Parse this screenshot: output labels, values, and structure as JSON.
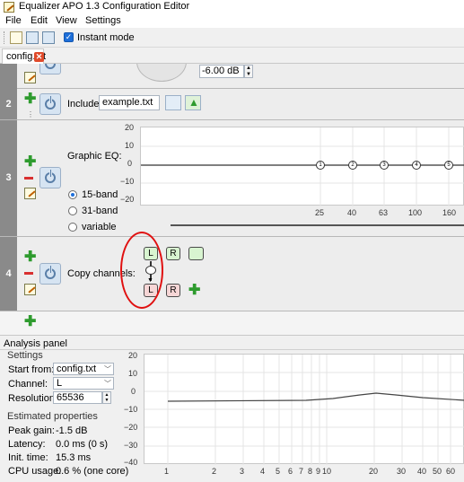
{
  "window": {
    "title": "Equalizer APO 1.3 Configuration Editor"
  },
  "menu": [
    "File",
    "Edit",
    "View",
    "Settings"
  ],
  "toolbar": {
    "instant_mode_label": "Instant mode",
    "instant_mode_checked": true
  },
  "tabs": [
    {
      "label": "config.txt"
    }
  ],
  "row1": {
    "gain_value": "-6.00 dB"
  },
  "row2": {
    "number": "2",
    "include_label": "Include:",
    "include_file": "example.txt"
  },
  "row3": {
    "number": "3",
    "label": "Graphic EQ:",
    "modes": [
      "15-band",
      "31-band",
      "variable"
    ],
    "selected_mode": "15-band",
    "y_ticks": [
      "20",
      "10",
      "0",
      "−10",
      "−20"
    ],
    "x_ticks": [
      "25",
      "40",
      "63",
      "100",
      "160"
    ],
    "band_nodes": [
      25,
      40,
      63,
      100,
      160
    ]
  },
  "row4": {
    "number": "4",
    "label": "Copy channels:",
    "top_channels": [
      "L",
      "R"
    ],
    "bottom_channels": [
      "L",
      "R"
    ]
  },
  "analysis": {
    "title": "Analysis panel",
    "settings_title": "Settings",
    "start_from_label": "Start from:",
    "start_from_value": "config.txt",
    "channel_label": "Channel:",
    "channel_value": "L",
    "resolution_label": "Resolution:",
    "resolution_value": "65536",
    "estimated_title": "Estimated properties",
    "peak_gain_label": "Peak gain:",
    "peak_gain_value": "-1.5 dB",
    "latency_label": "Latency:",
    "latency_value": "0.0 ms (0 s)",
    "init_time_label": "Init. time:",
    "init_time_value": "15.3 ms",
    "cpu_usage_label": "CPU usage:",
    "cpu_usage_value": "0.6 % (one core)",
    "y_ticks": [
      "20",
      "10",
      "0",
      "−10",
      "−20",
      "−30",
      "−40"
    ],
    "x_ticks": [
      "1",
      "2",
      "3",
      "4",
      "5",
      "6",
      "7",
      "8",
      "9",
      "10",
      "20",
      "30",
      "40",
      "50",
      "60"
    ]
  }
}
